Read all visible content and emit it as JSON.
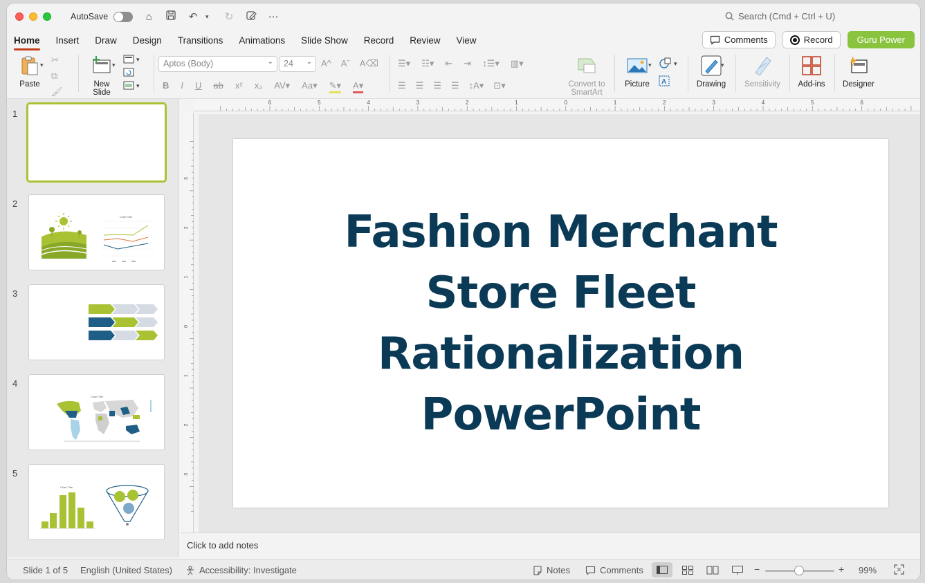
{
  "titlebar": {
    "autosave_label": "AutoSave",
    "search_placeholder": "Search (Cmd + Ctrl + U)"
  },
  "tabs": [
    {
      "label": "Home",
      "active": true
    },
    {
      "label": "Insert"
    },
    {
      "label": "Draw"
    },
    {
      "label": "Design"
    },
    {
      "label": "Transitions"
    },
    {
      "label": "Animations"
    },
    {
      "label": "Slide Show"
    },
    {
      "label": "Record"
    },
    {
      "label": "Review"
    },
    {
      "label": "View"
    }
  ],
  "header_buttons": {
    "comments": "Comments",
    "record": "Record",
    "addin": "Guru Power"
  },
  "ribbon": {
    "paste": "Paste",
    "new_slide": "New\nSlide",
    "font_name": "Aptos (Body)",
    "font_size": "24",
    "convert_smartart": "Convert to\nSmartArt",
    "picture": "Picture",
    "drawing": "Drawing",
    "sensitivity": "Sensitivity",
    "addins": "Add-ins",
    "designer": "Designer"
  },
  "thumbnails": [
    {
      "number": "1",
      "selected": true
    },
    {
      "number": "2"
    },
    {
      "number": "3"
    },
    {
      "number": "4",
      "chart_title": "Chart Title"
    },
    {
      "number": "5",
      "chart_title": "Chart Title"
    }
  ],
  "ruler": {
    "top_ticks": [
      "6",
      "5",
      "4",
      "3",
      "2",
      "1",
      "0",
      "1",
      "2",
      "3",
      "4",
      "5",
      "6"
    ],
    "left_ticks": [
      "3",
      "2",
      "1",
      "0",
      "1",
      "2",
      "3"
    ]
  },
  "slide": {
    "title_lines": [
      "Fashion Merchant",
      "Store Fleet",
      "Rationalization",
      "PowerPoint"
    ]
  },
  "notes_placeholder": "Click to add notes",
  "status": {
    "slide_counter": "Slide 1 of 5",
    "language": "English (United States)",
    "accessibility": "Accessibility: Investigate",
    "notes": "Notes",
    "comments": "Comments",
    "zoom": "99%"
  },
  "colors": {
    "accent_green": "#8ac43f",
    "title_navy": "#0b3a56",
    "tab_underline": "#c43e1c"
  }
}
